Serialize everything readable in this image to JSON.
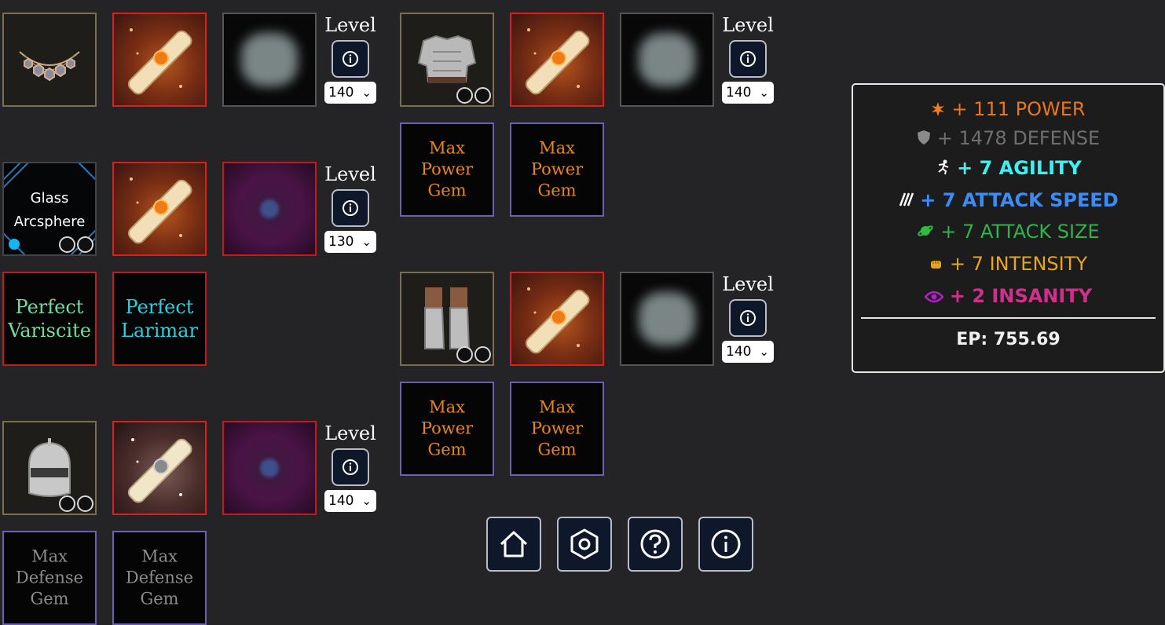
{
  "level_label": "Level",
  "equipment": {
    "amulet": {
      "name": "amulet",
      "level": "140"
    },
    "arcsphere": {
      "name_line1": "Glass",
      "name_line2": "Arcsphere",
      "level": "130"
    },
    "arcsphere_gems": [
      {
        "line1": "Perfect",
        "line2": "Variscite",
        "color": "#72dd9b"
      },
      {
        "line1": "Perfect",
        "line2": "Larimar",
        "color": "#22d3e3"
      }
    ],
    "helmet": {
      "level": "140"
    },
    "helmet_gems": [
      {
        "line1": "Max",
        "line2": "Defense",
        "line3": "Gem"
      },
      {
        "line1": "Max",
        "line2": "Defense",
        "line3": "Gem"
      }
    ],
    "chestplate": {
      "level": "140"
    },
    "chestplate_gems": [
      {
        "line1": "Max",
        "line2": "Power",
        "line3": "Gem"
      },
      {
        "line1": "Max",
        "line2": "Power",
        "line3": "Gem"
      }
    ],
    "leggings": {
      "level": "140"
    },
    "leggings_gems": [
      {
        "line1": "Max",
        "line2": "Power",
        "line3": "Gem"
      },
      {
        "line1": "Max",
        "line2": "Power",
        "line3": "Gem"
      }
    ]
  },
  "stats": [
    {
      "icon": "power-icon",
      "text": "+ 111 POWER",
      "color": "#e8761c"
    },
    {
      "icon": "defense-shield-icon",
      "text": "+ 1478 DEFENSE",
      "color": "#6f6f6f"
    },
    {
      "icon": "agility-runner-icon",
      "text": "+ 7 AGILITY",
      "color": "#3ff0f0"
    },
    {
      "icon": "attack-speed-icon",
      "text": "+ 7 ATTACK SPEED",
      "color": "#3c8cf5"
    },
    {
      "icon": "attack-size-planet-icon",
      "text": "+ 7 ATTACK SIZE",
      "color": "#2fb34a"
    },
    {
      "icon": "intensity-fist-icon",
      "text": "+ 7 INTENSITY",
      "color": "#e9a51c"
    },
    {
      "icon": "insanity-eye-icon",
      "text": "+ 2 INSANITY",
      "color": "#d12f8a"
    }
  ],
  "ep": "EP: 755.69",
  "nav": [
    "home-icon",
    "settings-icon",
    "help-icon",
    "info-icon"
  ]
}
